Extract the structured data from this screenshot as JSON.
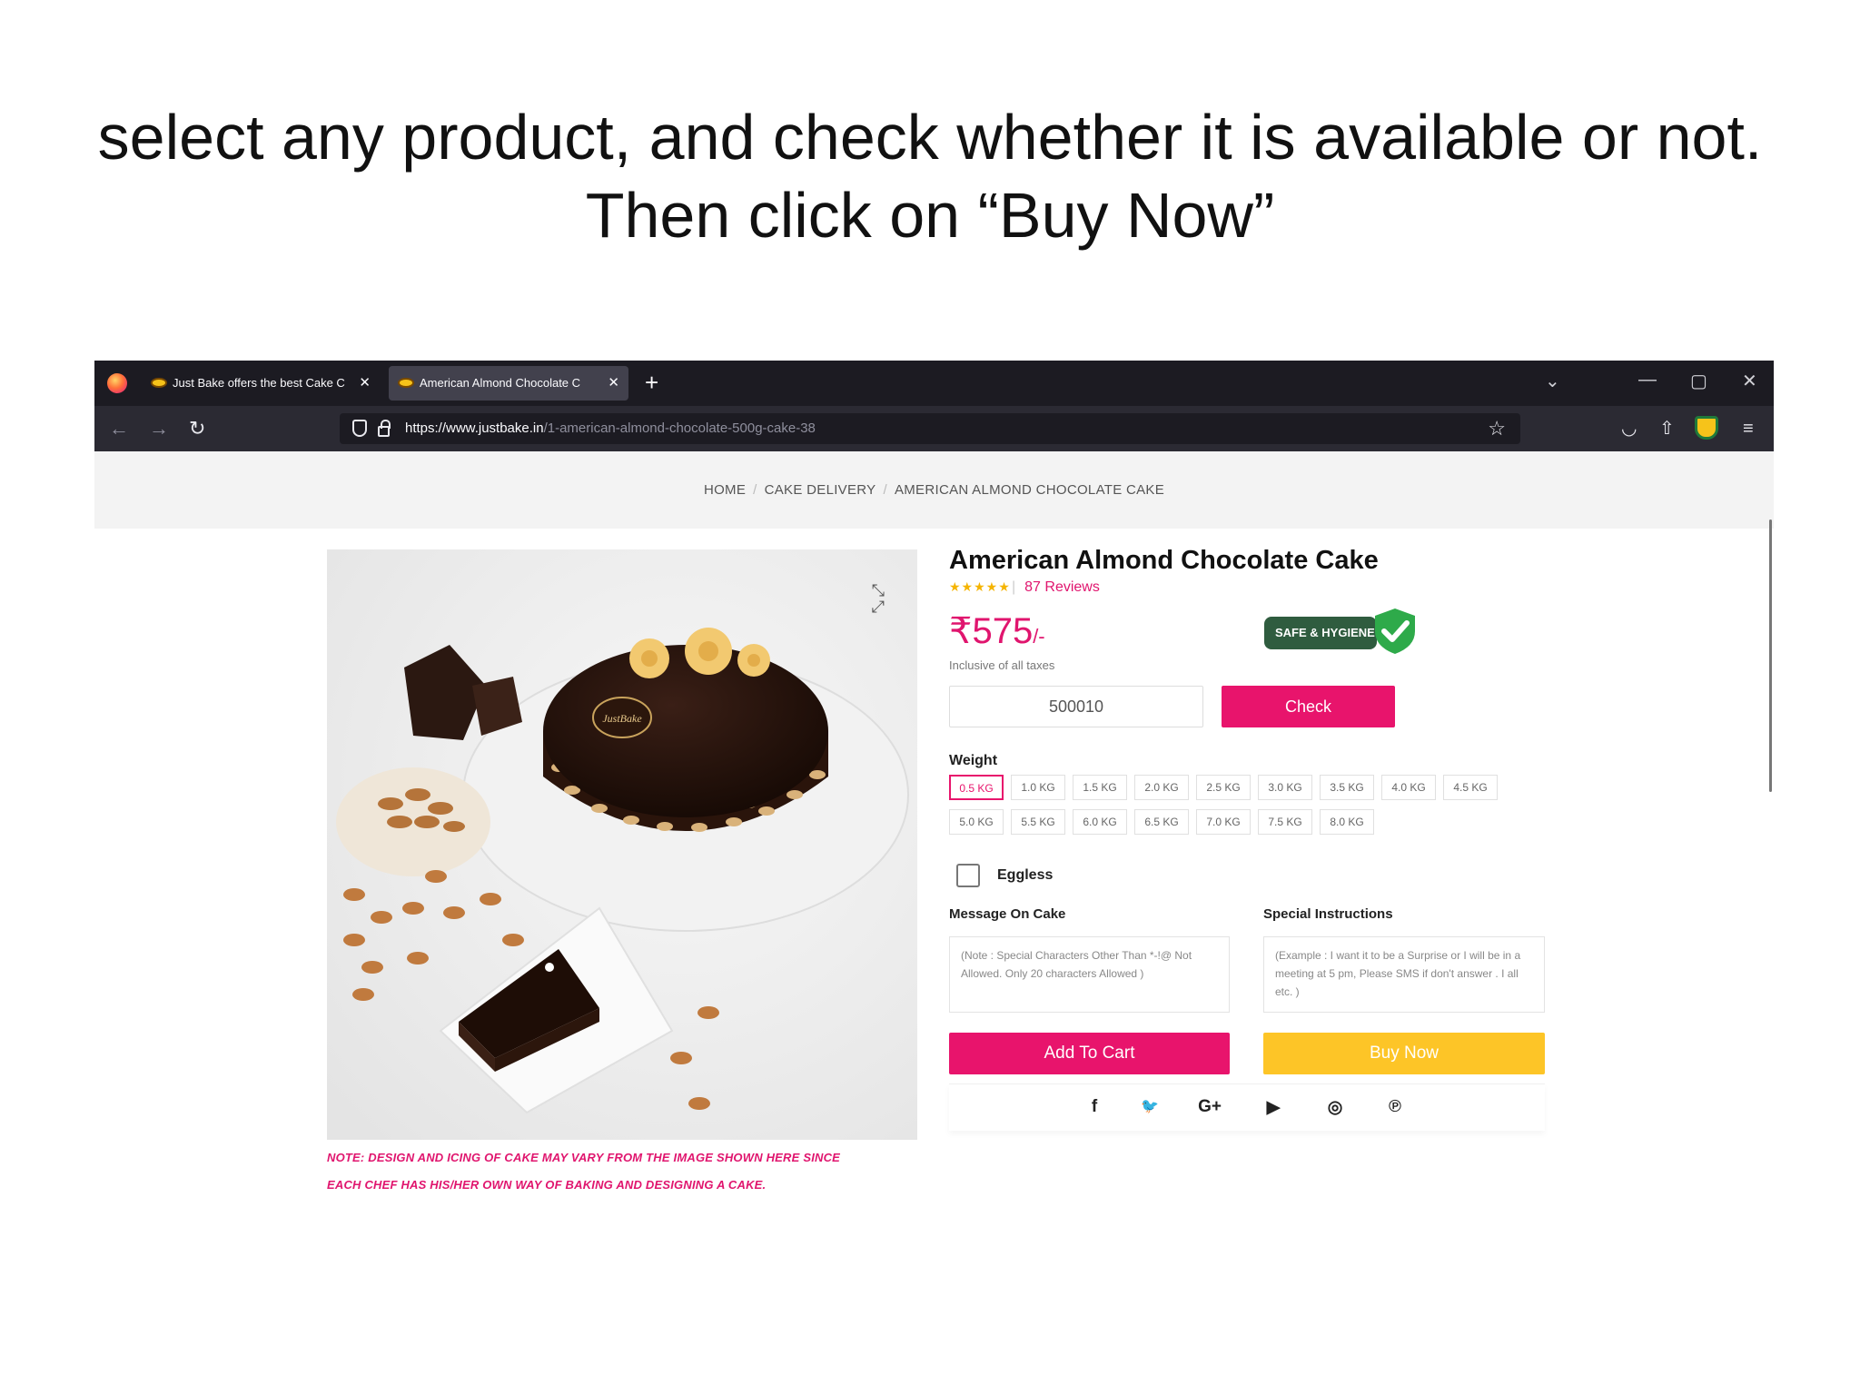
{
  "slide": {
    "instruction_line1": "select any product, and check whether it is available or not.",
    "instruction_line2": "Then click on “Buy Now”"
  },
  "browser": {
    "tabs": [
      {
        "label": "Just Bake offers the best Cake C",
        "close": "✕"
      },
      {
        "label": "American Almond Chocolate C",
        "close": "✕"
      }
    ],
    "new_tab": "+",
    "url_host": "https://www.justbake.in",
    "url_path": "/1-american-almond-chocolate-500g-cake-38",
    "window_controls": {
      "list": "⌄",
      "minimize": "—",
      "restore": "▢",
      "close": "✕"
    }
  },
  "breadcrumb": [
    "HOME",
    "CAKE DELIVERY",
    "AMERICAN ALMOND CHOCOLATE CAKE"
  ],
  "product": {
    "title": "American Almond Chocolate Cake",
    "stars": "★★★★★",
    "reviews": "87 Reviews",
    "price": "₹575",
    "price_suffix": "/-",
    "tax_note": "Inclusive of all taxes",
    "badge": "SAFE & HYGIENE",
    "image_note_line1": "NOTE: DESIGN AND ICING OF CAKE MAY VARY FROM THE IMAGE SHOWN HERE SINCE",
    "image_note_line2": "EACH CHEF HAS HIS/HER OWN WAY OF BAKING AND DESIGNING A CAKE.",
    "cake_logo_text": "JustBake"
  },
  "pincode": {
    "value": "500010",
    "check_label": "Check"
  },
  "weight": {
    "label": "Weight",
    "options": [
      "0.5 KG",
      "1.0 KG",
      "1.5 KG",
      "2.0 KG",
      "2.5 KG",
      "3.0 KG",
      "3.5 KG",
      "4.0 KG",
      "4.5 KG",
      "5.0 KG",
      "5.5 KG",
      "6.0 KG",
      "6.5 KG",
      "7.0 KG",
      "7.5 KG",
      "8.0 KG"
    ],
    "selected": "0.5 KG"
  },
  "eggless": {
    "label": "Eggless",
    "checked": false
  },
  "message": {
    "label": "Message On Cake",
    "placeholder": "(Note : Special Characters Other Than *-!@ Not Allowed.  Only 20 characters Allowed )"
  },
  "instructions": {
    "label": "Special Instructions",
    "placeholder": "(Example : I want it to be a Surprise or I will be in a meeting at 5 pm, Please SMS if don't answer . I all etc. )"
  },
  "actions": {
    "add_to_cart": "Add To Cart",
    "buy_now": "Buy Now"
  },
  "social": [
    "f",
    "🐦",
    "G+",
    "▶",
    "◎",
    "℗"
  ],
  "colors": {
    "accent": "#e8146c",
    "buy": "#fdc527",
    "chrome_dark": "#1c1b22"
  }
}
